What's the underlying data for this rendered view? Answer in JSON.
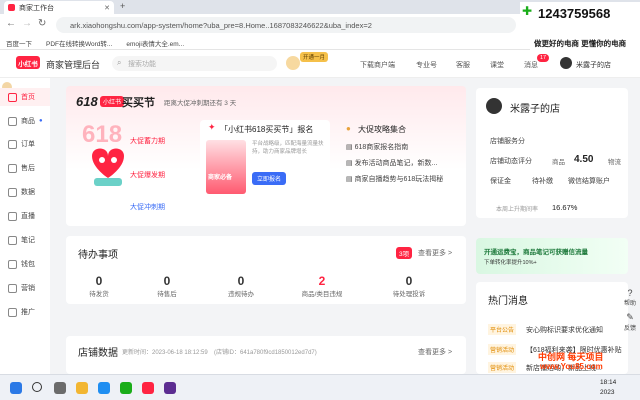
{
  "browser": {
    "tab_title": "商家工作台",
    "url": "ark.xiaohongshu.com/app-system/home?uba_pre=8.Home..1687083246622&uba_index=2",
    "bookmarks": [
      "百度一下",
      "PDF在线转换Word转...",
      "emoji表情大全.em..."
    ]
  },
  "overlay": {
    "phone": "1243759568",
    "banner": "做更好的电商 更懂你的电商"
  },
  "header": {
    "logo": "小红书",
    "title": "商家管理后台",
    "search_placeholder": "搜索功能",
    "nav": [
      "下载商户端",
      "专业号",
      "客服",
      "课堂",
      "消息"
    ],
    "message_badge": "17",
    "event_badge": "开通一月",
    "shop_name": "米露子的店"
  },
  "sidebar": [
    {
      "label": "首页",
      "active": true
    },
    {
      "label": "商品"
    },
    {
      "label": "订单"
    },
    {
      "label": "售后"
    },
    {
      "label": "数据"
    },
    {
      "label": "直播"
    },
    {
      "label": "笔记"
    },
    {
      "label": "钱包"
    },
    {
      "label": "营销"
    },
    {
      "label": "推广"
    }
  ],
  "promo": {
    "brand": "618",
    "tag": "小红书",
    "name": "买买节",
    "notice": "距离大促冲刺期还有 3 天",
    "phases": [
      "大促蓄力期",
      "大促爆发期",
      "大促冲刺期"
    ],
    "signup_title": "「小红书618买买节」报名",
    "signup_desc": "平台战略级，匹配海量流量扶持，助力商家品牌增长",
    "signup_button": "立即报名",
    "badge_text": "商家必备",
    "guide_title": "大促攻略集合",
    "guide_items": [
      "618商家报名指南",
      "发布活动商品笔记，新数...",
      "商家自播趋势与618玩法揭秘"
    ]
  },
  "todo": {
    "title": "待办事项",
    "count": "3项",
    "more": "查看更多 >",
    "items": [
      {
        "value": "0",
        "label": "待发货"
      },
      {
        "value": "0",
        "label": "待售后"
      },
      {
        "value": "0",
        "label": "违规待办"
      },
      {
        "value": "2",
        "label": "商品/类目违规"
      },
      {
        "value": "0",
        "label": "待处理投诉"
      }
    ]
  },
  "shop_data": {
    "title": "店铺数据",
    "update_time": "更新时间：2023-06-18 18:12:59",
    "store_id": "(店铺ID：641a780f9cd1850012ed7d7)",
    "more": "查看更多 >"
  },
  "shop_card": {
    "name": "米露子的店",
    "service_title": "店铺服务分",
    "rating_label": "店铺动态评分",
    "rating_sub": "商品",
    "rating_value": "4.50",
    "rating_tag": "物流",
    "rows": [
      "保证金",
      "待补缴",
      "微信结算账户"
    ],
    "rate_text": "本周上升期间率",
    "rate_value": "16.67%"
  },
  "green_banner": {
    "line1": "开通运费宝，商品笔记可获赠信流量",
    "line2": "下单转化率提升10%+"
  },
  "hot": {
    "title": "热门消息",
    "items": [
      {
        "tag": "平台公告",
        "text": "安心购标识要求优化通知"
      },
      {
        "tag": "营销活动",
        "text": "【618福利来袭】限时优惠补贴"
      },
      {
        "tag": "营销活动",
        "text": "新店铺活动，新品上线..."
      }
    ]
  },
  "float_buttons": [
    "帮助",
    "反馈"
  ],
  "watermark": {
    "line1": "中创网 每天项目",
    "line2": "www.You85.com"
  },
  "taskbar": {
    "time": "18:14",
    "date": "2023"
  },
  "colors": {
    "brand": "#ff2442",
    "accent_blue": "#3a6cf6"
  }
}
